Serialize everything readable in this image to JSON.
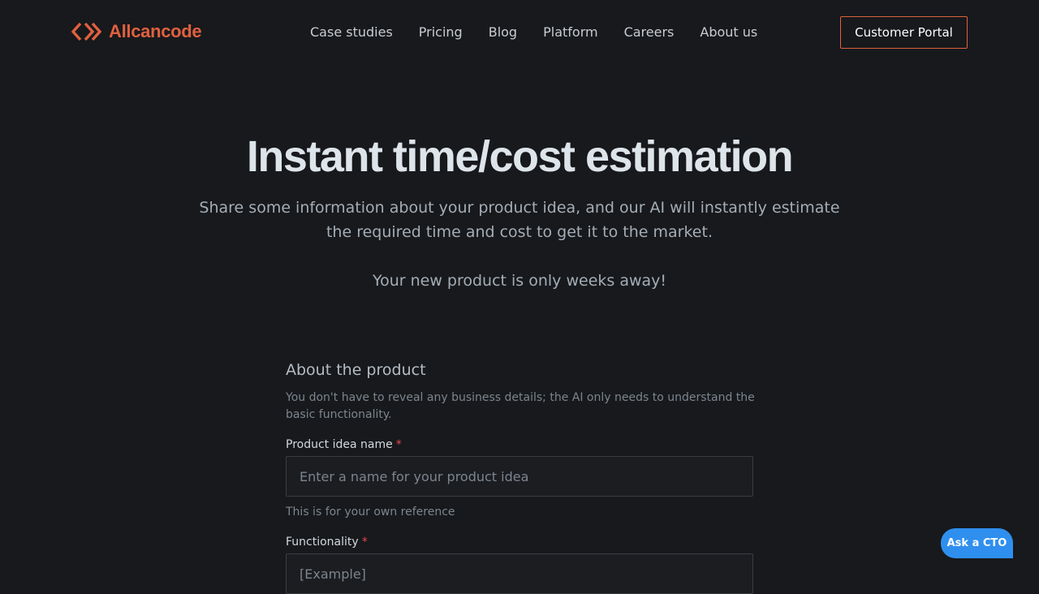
{
  "brand": {
    "name": "Allcancode",
    "logo_icon": "code-chevrons-icon",
    "accent_color": "#e0603f"
  },
  "nav": {
    "links": [
      "Case studies",
      "Pricing",
      "Blog",
      "Platform",
      "Careers",
      "About us"
    ],
    "portal_button": "Customer Portal"
  },
  "hero": {
    "title": "Instant time/cost estimation",
    "subtitle": "Share some information about your product idea, and our AI will instantly estimate the required time and cost to get it to the market.",
    "tagline": "Your new product is only weeks away!"
  },
  "form": {
    "title": "About the product",
    "description": "You don't have to reveal any business details; the AI only needs to understand the basic functionality.",
    "required_marker": "*",
    "product_name": {
      "label": "Product idea name",
      "placeholder": "Enter a name for your product idea",
      "hint": "This is for your own reference"
    },
    "functionality": {
      "label": "Functionality",
      "placeholder": "[Example]"
    }
  },
  "chat_button": {
    "label": "Ask a CTO",
    "color": "#2f8fef"
  }
}
